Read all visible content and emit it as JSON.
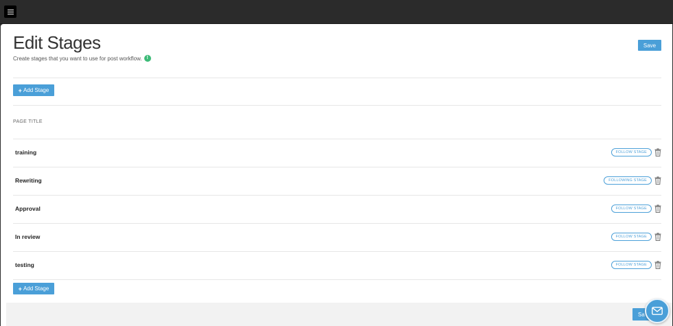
{
  "page": {
    "title": "Edit Stages",
    "subtitle": "Create stages that you want to use for post workflow.",
    "info_icon": "info-icon"
  },
  "buttons": {
    "save": "Save",
    "save_bottom": "Sa",
    "add_stage": "Add Stage",
    "add_stage_plus": "+"
  },
  "table": {
    "header": "PAGE TITLE",
    "rows": [
      {
        "name": "training",
        "tag": "FOLLOW STAGE"
      },
      {
        "name": "Rewriting",
        "tag": "FOLLOWING STAGE"
      },
      {
        "name": "Approval",
        "tag": "FOLLOW STAGE"
      },
      {
        "name": "In review",
        "tag": "FOLLOW STAGE"
      },
      {
        "name": "testing",
        "tag": "FOLLOW STAGE"
      }
    ]
  },
  "colors": {
    "accent": "#4a9fd8",
    "info_green": "#3dbb78",
    "topbar": "#2b2b2b"
  },
  "icons": {
    "menu": "hamburger-menu-icon",
    "delete": "trash-icon",
    "chat": "envelope-icon"
  }
}
